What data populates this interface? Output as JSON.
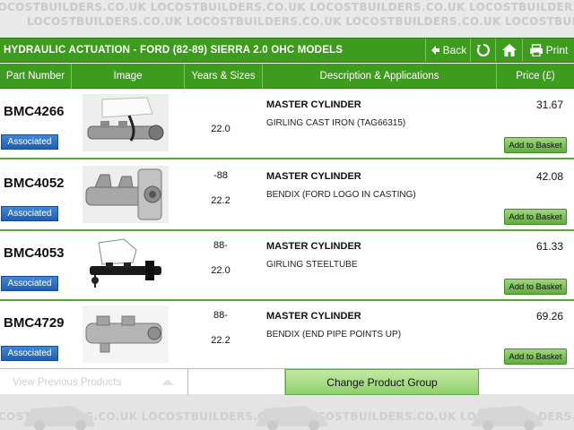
{
  "watermark": {
    "text": "LOCOSTBUILDERS.CO.UK",
    "line": "LOCOSTBUILDERS.CO.UK  LOCOSTBUILDERS.CO.UK  LOCOSTBUILDERS.CO.UK  LOCOSTBUILDERS.CO.UK  LOCOSTBUILDERS.CO.UK"
  },
  "header": {
    "title": "HYDRAULIC ACTUATION - FORD (82-89) SIERRA 2.0 OHC  MODELS",
    "back_label": "Back",
    "print_label": "Print",
    "icons": [
      "back-arrow-icon",
      "refresh-icon",
      "home-icon",
      "printer-icon"
    ]
  },
  "columns": {
    "part_number": "Part Number",
    "image": "Image",
    "years_sizes": "Years & Sizes",
    "description": "Description & Applications",
    "price": "Price (£)"
  },
  "products": [
    {
      "part_number": "BMC4266",
      "years": "",
      "size": "22.0",
      "title": "MASTER CYLINDER",
      "application": "GIRLING CAST IRON (TAG66315)",
      "price": "31.67",
      "associated_label": "Associated",
      "basket_label": "Add to Basket"
    },
    {
      "part_number": "BMC4052",
      "years": "-88",
      "size": "22.2",
      "title": "MASTER CYLINDER",
      "application": "BENDIX (FORD LOGO IN CASTING)",
      "price": "42.08",
      "associated_label": "Associated",
      "basket_label": "Add to Basket"
    },
    {
      "part_number": "BMC4053",
      "years": "88-",
      "size": "22.0",
      "title": "MASTER CYLINDER",
      "application": "GIRLING STEELTUBE",
      "price": "61.33",
      "associated_label": "Associated",
      "basket_label": "Add to Basket"
    },
    {
      "part_number": "BMC4729",
      "years": "88-",
      "size": "22.2",
      "title": "MASTER CYLINDER",
      "application": "BENDIX (END PIPE POINTS UP)",
      "price": "69.26",
      "associated_label": "Associated",
      "basket_label": "Add to Basket"
    }
  ],
  "footer": {
    "previous_label": "View Previous Products",
    "change_group_label": "Change Product Group"
  },
  "colors": {
    "brand_green": "#3d9b1e",
    "associated_blue": "#1d5fb0",
    "basket_green": "#5fae3c"
  }
}
